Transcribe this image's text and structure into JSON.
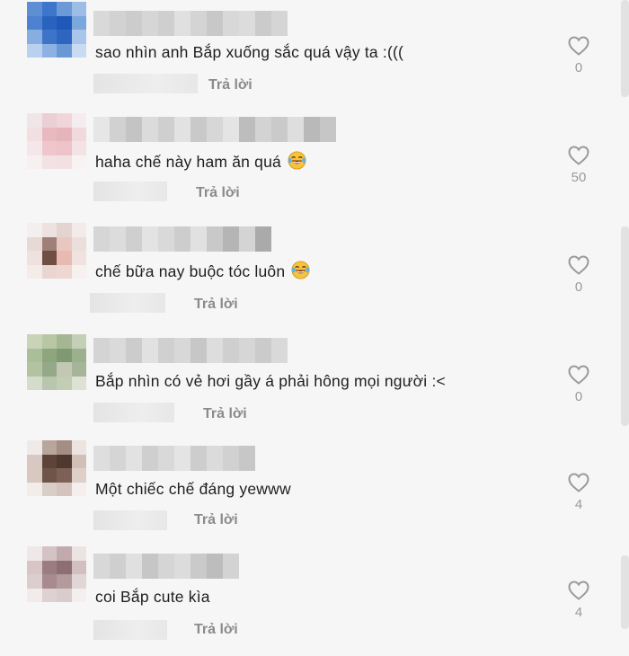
{
  "comments": [
    {
      "text": "sao nhìn anh Bắp xuống sắc quá vậy ta :(((",
      "reply_label": "Trả lời",
      "like_count": "0",
      "emoji": false,
      "avatar_colors": [
        "#5e8fd2",
        "#3d76cb",
        "#6b9ad7",
        "#9cbde6",
        "#4d82d0",
        "#2a63be",
        "#1f58b8",
        "#7aa7dc",
        "#87aee0",
        "#3e74c8",
        "#2d66bf",
        "#a9c6ea",
        "#b9d0ee",
        "#8cb1e2",
        "#6a98d6",
        "#c8dbf2"
      ]
    },
    {
      "text": "haha chế này ham ăn quá",
      "reply_label": "Trả lời",
      "like_count": "50",
      "emoji": true,
      "avatar_colors": [
        "#f1e6e7",
        "#ead0d4",
        "#f0d6da",
        "#f4ecee",
        "#f2dfe1",
        "#e9b9c0",
        "#e6b5bb",
        "#f1dadd",
        "#f5e7e9",
        "#eec6cc",
        "#edc2c9",
        "#f3e3e5",
        "#f7f0f1",
        "#f3e2e4",
        "#f2e0e2",
        "#f8f2f3"
      ]
    },
    {
      "text": "chế bữa nay buộc tóc luôn",
      "reply_label": "Trả lời",
      "like_count": "0",
      "emoji": true,
      "avatar_colors": [
        "#f3efee",
        "#ede2df",
        "#e4d4d0",
        "#f2ebe9",
        "#e7d9d6",
        "#9f8078",
        "#e9c7c0",
        "#ecdeda",
        "#efe2de",
        "#6f4e44",
        "#e8bab2",
        "#f0e2df",
        "#f4ece9",
        "#e9d6d1",
        "#eed6d1",
        "#f6f1ef"
      ]
    },
    {
      "text": "Bắp nhìn có vẻ hơi gầy á phải hông mọi người :<",
      "reply_label": "Trả lời",
      "like_count": "0",
      "emoji": false,
      "avatar_colors": [
        "#c9d3b8",
        "#b8c7a4",
        "#a4b693",
        "#c5ceb6",
        "#a9bf9a",
        "#8ea57e",
        "#7f9a72",
        "#9bb08c",
        "#b3c3a1",
        "#93a987",
        "#c2c8b4",
        "#a6b59a",
        "#d5dccb",
        "#b9c6ae",
        "#c2cdb4",
        "#dde2d4"
      ]
    },
    {
      "text": "Một chiếc chế đáng yewww",
      "reply_label": "Trả lời",
      "like_count": "4",
      "emoji": false,
      "avatar_colors": [
        "#efeae7",
        "#b8a59b",
        "#a48d83",
        "#ece4e0",
        "#d7c8c1",
        "#5d443b",
        "#4e3830",
        "#d2c0b8",
        "#d9c8c0",
        "#6e5449",
        "#7d6156",
        "#ded0c9",
        "#f2ecea",
        "#d9cdc8",
        "#d4c4bd",
        "#f4efed"
      ]
    },
    {
      "text": "coi Bắp cute kìa",
      "reply_label": "Trả lời",
      "like_count": "4",
      "emoji": false,
      "avatar_colors": [
        "#efe8e8",
        "#d4c3c4",
        "#c2aaac",
        "#ece3e3",
        "#d8c6c7",
        "#9b7d80",
        "#8d6e72",
        "#d2bfc1",
        "#dccdcf",
        "#a88b8e",
        "#b39a9c",
        "#e2d5d6",
        "#f1ebeb",
        "#ddd1d2",
        "#d9cccd",
        "#f4efef"
      ]
    }
  ],
  "colors": {
    "text": "#1f1f1f",
    "muted": "#8b8b8b",
    "heart_outline": "#9a9a9a",
    "background": "#f6f6f6"
  },
  "icons": {
    "like": "heart-outline-icon",
    "emoji": "laughing-tears-emoji-icon"
  }
}
